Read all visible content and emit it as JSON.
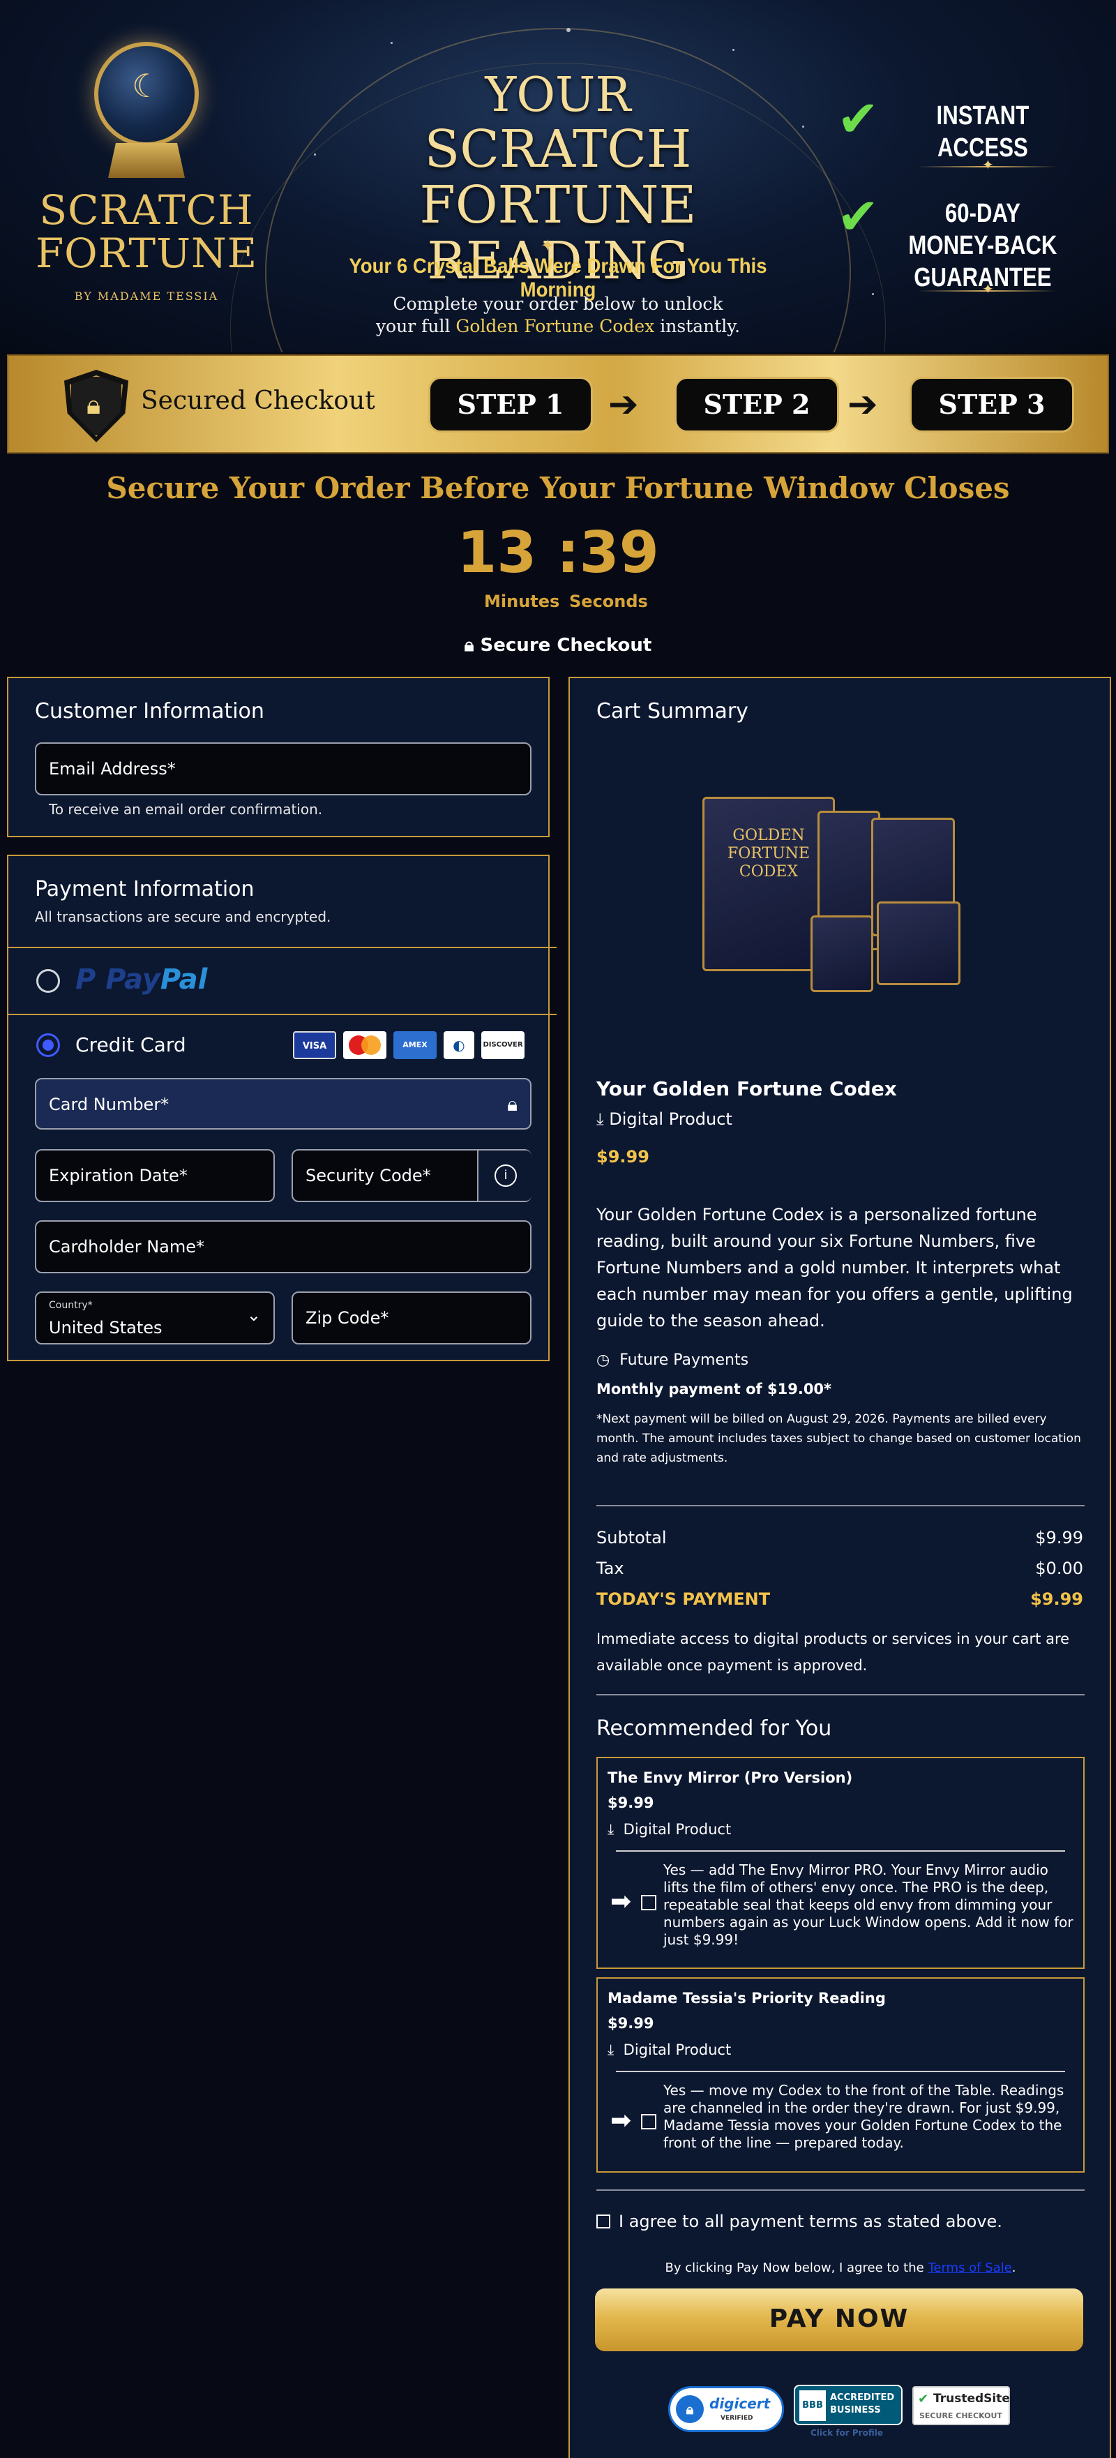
{
  "banner": {
    "logo_line1": "SCRATCH",
    "logo_line2": "FORTUNE",
    "logo_byline": "BY MADAME TESSIA",
    "title_line1": "YOUR",
    "title_line2": "SCRATCH FORTUNE",
    "title_line3": "READING",
    "subtitle": "Your 6 Crystal Balls Were Drawn For You This Morning",
    "desc_line1": "Complete your order below to unlock",
    "desc_line2_prefix": "your full ",
    "desc_line2_highlight": "Golden Fortune Codex",
    "desc_line2_suffix": " instantly.",
    "perk1": "INSTANT ACCESS",
    "perk2_line1": "60-DAY MONEY-BACK",
    "perk2_line2": "GUARANTEE"
  },
  "checkout_bar": {
    "label": "Secured Checkout",
    "steps": [
      "STEP 1",
      "STEP 2",
      "STEP 3"
    ]
  },
  "countdown": {
    "headline": "Secure Your Order Before Your Fortune Window Closes",
    "minutes": "13",
    "separator": ":",
    "seconds": "39",
    "minutes_label": "Minutes",
    "seconds_label": "Seconds",
    "secure_label": "Secure Checkout"
  },
  "customer": {
    "title": "Customer Information",
    "email_label": "Email Address*",
    "email_hint": "To receive an email order confirmation."
  },
  "payment": {
    "title": "Payment Information",
    "subtitle": "All transactions are secure and encrypted.",
    "paypal_label_a": "Pay",
    "paypal_label_b": "Pal",
    "credit_label": "Credit Card",
    "cards": [
      "VISA",
      "MC",
      "AMEX",
      "DC",
      "DISCOVER"
    ],
    "card_number": "Card Number*",
    "expiration": "Expiration Date*",
    "security_code": "Security Code*",
    "cardholder": "Cardholder Name*",
    "country_label": "Country*",
    "country_value": "United States",
    "zip": "Zip Code*"
  },
  "cart": {
    "title": "Cart Summary",
    "product_name": "Your Golden Fortune Codex",
    "product_type": "Digital Product",
    "price": "$9.99",
    "description": "Your Golden Fortune Codex is a personalized fortune reading, built around your six Fortune Numbers, five Fortune Numbers and a gold number. It interprets what each number may mean for you offers a gentle, uplifting guide to the season ahead.",
    "future_label": "Future Payments",
    "monthly": "Monthly payment of $19.00*",
    "monthly_note": "*Next payment will be billed on August 29, 2026. Payments are billed every month. The amount includes taxes subject to change based on customer location and rate adjustments.",
    "subtotal_label": "Subtotal",
    "subtotal_value": "$9.99",
    "tax_label": "Tax",
    "tax_value": "$0.00",
    "today_label": "TODAY'S PAYMENT",
    "today_value": "$9.99",
    "access_note": "Immediate access to digital products or services in your cart are available once payment is approved.",
    "recommended_title": "Recommended for You",
    "recs": [
      {
        "name": "The Envy Mirror (Pro Version)",
        "price": "$9.99",
        "type": "Digital Product",
        "offer": "Yes — add The Envy Mirror PRO. Your Envy Mirror audio lifts the film of others' envy once. The PRO is the deep, repeatable seal that keeps old envy from dimming your numbers again as your Luck Window opens. Add it now for just $9.99!"
      },
      {
        "name": "Madame Tessia's Priority Reading",
        "price": "$9.99",
        "type": "Digital Product",
        "offer": "Yes — move my Codex to the front of the Table. Readings are channeled in the order they're drawn. For just $9.99, Madame Tessia moves your Golden Fortune Codex to the front of the line — prepared today."
      }
    ],
    "agree_label": "I agree to all payment terms as stated above.",
    "terms_prefix": "By clicking Pay Now below, I agree to the ",
    "terms_link": "Terms of Sale",
    "terms_suffix": ".",
    "pay_button": "PAY NOW",
    "badge_digicert": "digicert",
    "badge_digicert_sub": "VERIFIED",
    "badge_bbb_line1": "ACCREDITED",
    "badge_bbb_line2": "BUSINESS",
    "badge_bbb_sub": "Click for Profile",
    "badge_trusted": "TrustedSite",
    "badge_trusted_sub": "SECURE CHECKOUT"
  }
}
